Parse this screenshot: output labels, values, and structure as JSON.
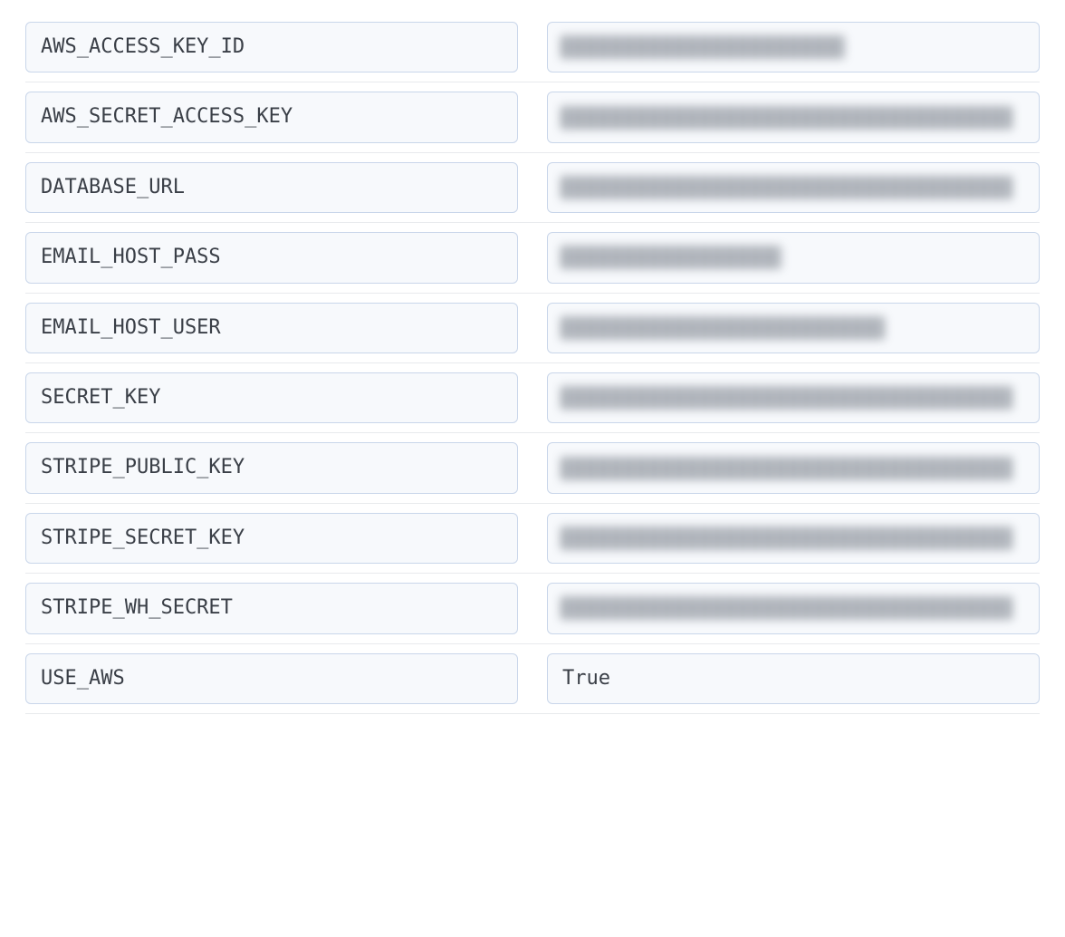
{
  "env_vars": [
    {
      "key": "AWS_ACCESS_KEY_ID",
      "value": "",
      "masked": true,
      "mask_w": "w-58"
    },
    {
      "key": "AWS_SECRET_ACCESS_KEY",
      "value": "",
      "masked": true,
      "mask_w": "w-92"
    },
    {
      "key": "DATABASE_URL",
      "value": "",
      "masked": true,
      "mask_w": "w-92"
    },
    {
      "key": "EMAIL_HOST_PASS",
      "value": "",
      "masked": true,
      "mask_w": "w-45"
    },
    {
      "key": "EMAIL_HOST_USER",
      "value": "",
      "masked": true,
      "mask_w": "w-66"
    },
    {
      "key": "SECRET_KEY",
      "value": "",
      "masked": true,
      "mask_w": "w-92"
    },
    {
      "key": "STRIPE_PUBLIC_KEY",
      "value": "",
      "masked": true,
      "mask_w": "w-92"
    },
    {
      "key": "STRIPE_SECRET_KEY",
      "value": "",
      "masked": true,
      "mask_w": "w-92"
    },
    {
      "key": "STRIPE_WH_SECRET",
      "value": "",
      "masked": true,
      "mask_w": "w-92"
    },
    {
      "key": "USE_AWS",
      "value": "True",
      "masked": false,
      "mask_w": ""
    }
  ]
}
